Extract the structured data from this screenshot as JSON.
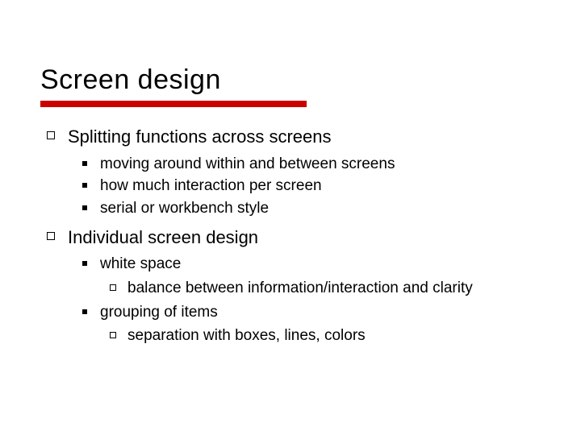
{
  "title": "Screen design",
  "items": [
    {
      "label": "Splitting functions across screens",
      "children": [
        {
          "label": "moving around within and between screens"
        },
        {
          "label": "how much interaction per screen"
        },
        {
          "label": "serial or workbench style"
        }
      ]
    },
    {
      "label": "Individual screen design",
      "children": [
        {
          "label": "white space",
          "children": [
            {
              "label": "balance between information/interaction and clarity"
            }
          ]
        },
        {
          "label": "grouping of items",
          "children": [
            {
              "label": "separation with boxes, lines, colors"
            }
          ]
        }
      ]
    }
  ]
}
